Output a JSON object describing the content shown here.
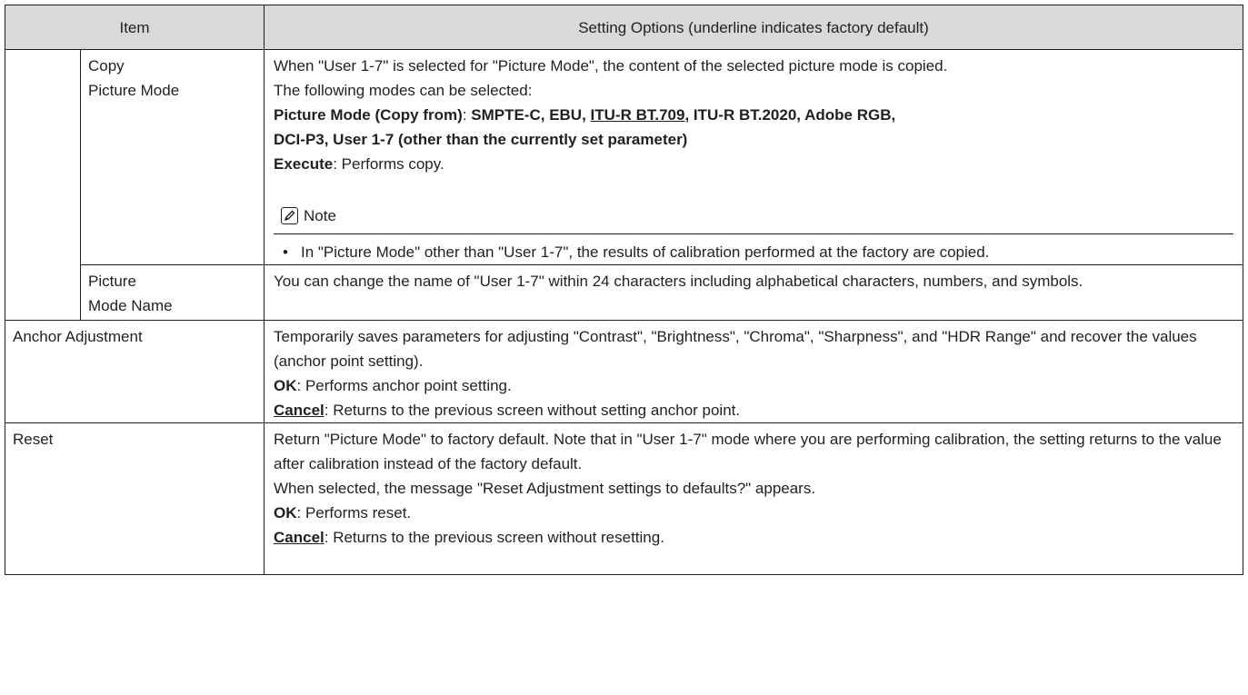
{
  "header": {
    "item": "Item",
    "options": "Setting Options (underline indicates factory default)"
  },
  "copy_picture_mode": {
    "item_line1": "Copy",
    "item_line2": "Picture Mode",
    "desc": "When \"User 1-7\" is selected for \"Picture Mode\", the content of the selected picture mode is copied.",
    "modes_intro": "The following modes can be selected:",
    "copy_from_label": "Picture Mode (Copy from)",
    "colon": ": ",
    "mode_a": "SMPTE-C, EBU, ",
    "mode_default": "ITU-R BT.709",
    "mode_b": ", ITU-R BT.2020, Adobe RGB,",
    "mode_c": "DCI-P3, User 1-7 (other than the currently set parameter)",
    "execute_label": "Execute",
    "execute_desc": ": Performs copy.",
    "note_title": "Note",
    "note_text": "In \"Picture Mode\" other than \"User 1-7\", the results of calibration performed at the factory are copied."
  },
  "picture_mode_name": {
    "item_line1": "Picture",
    "item_line2": "Mode Name",
    "desc": "You can change the name of \"User 1-7\" within 24 characters including alphabetical characters, numbers, and symbols."
  },
  "anchor_adjustment": {
    "item": "Anchor Adjustment",
    "desc": "Temporarily saves parameters for adjusting \"Contrast\", \"Brightness\", \"Chroma\", \"Sharpness\", and \"HDR Range\" and recover the values (anchor point setting).",
    "ok_label": "OK",
    "ok_desc": ": Performs anchor point setting.",
    "cancel_label": "Cancel",
    "cancel_desc": ": Returns to the previous screen without setting anchor point."
  },
  "reset": {
    "item": "Reset",
    "desc": "Return \"Picture Mode\" to factory default. Note that in \"User 1-7\" mode where you are performing calibration, the setting returns to the value after calibration instead of the factory default.",
    "message": "When selected, the message \"Reset Adjustment settings to defaults?\" appears.",
    "ok_label": "OK",
    "ok_desc": ": Performs reset.",
    "cancel_label": "Cancel",
    "cancel_desc": ": Returns to the previous screen without resetting."
  },
  "bullet": "•"
}
